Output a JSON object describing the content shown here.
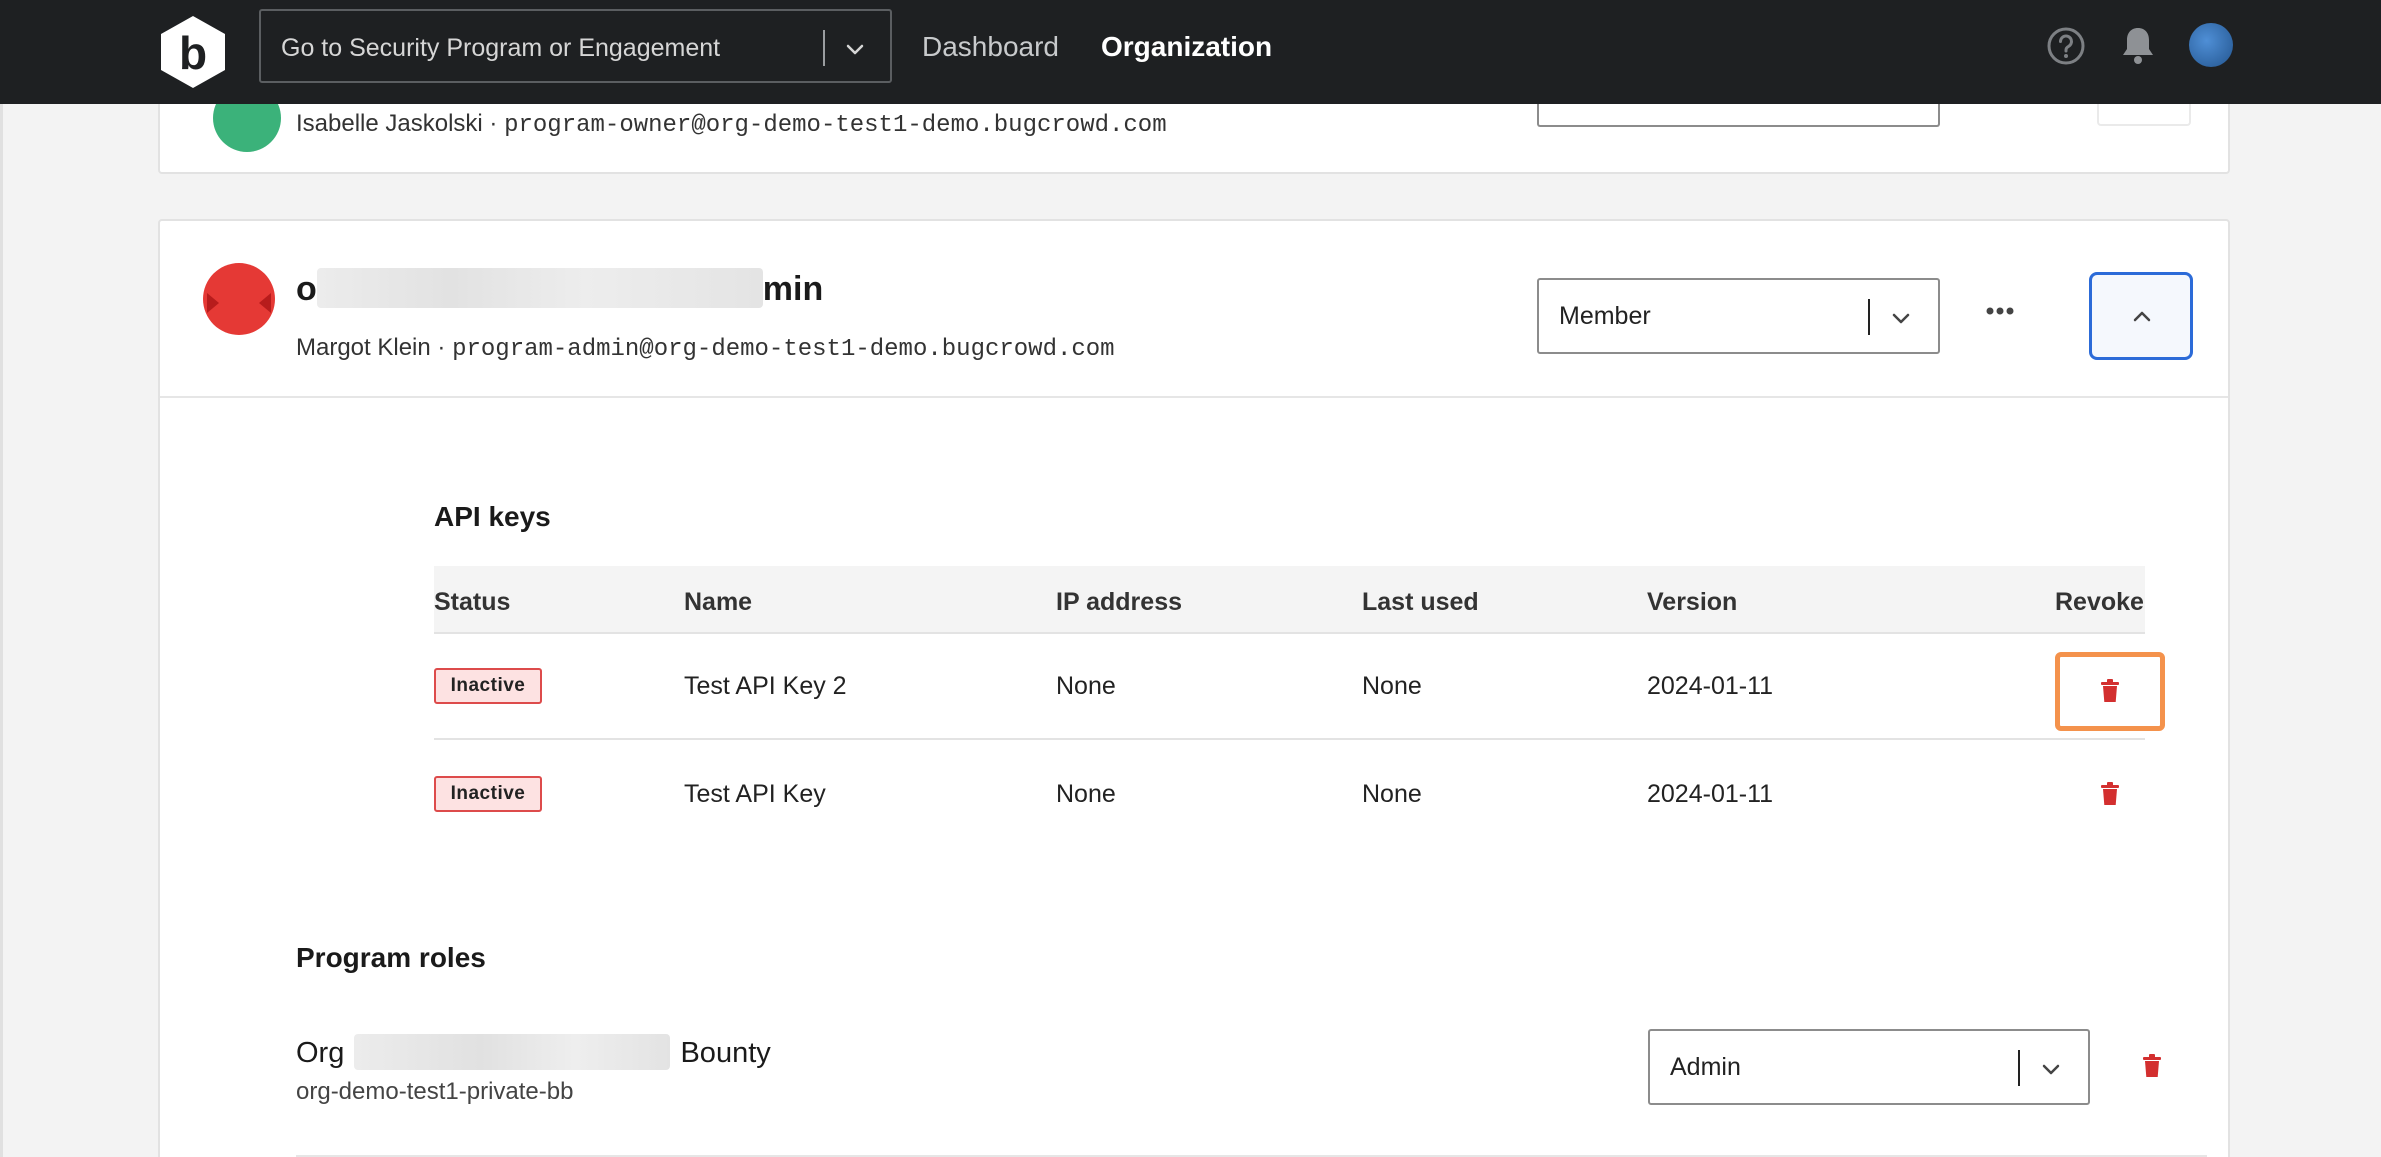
{
  "nav": {
    "logo_letter": "b",
    "search_placeholder": "Go to Security Program or Engagement",
    "links": [
      "Dashboard",
      "Organization"
    ],
    "icons": [
      "help-circle-icon",
      "bell-icon",
      "user-avatar"
    ]
  },
  "member_1": {
    "name": "Isabelle Jaskolski",
    "separator": "·",
    "email": "program-owner@org-demo-test1-demo.bugcrowd.com"
  },
  "member_2": {
    "username_start": "o",
    "username_end": "min",
    "name": "Margot Klein",
    "separator": "·",
    "email": "program-admin@org-demo-test1-demo.bugcrowd.com",
    "role": "Member",
    "actions": [
      "more-icon",
      "chevron-up-icon"
    ]
  },
  "api_keys": {
    "title": "API keys",
    "columns": [
      "Status",
      "Name",
      "IP address",
      "Last used",
      "Version",
      "Revoke"
    ],
    "rows": [
      {
        "status": "Inactive",
        "name": "Test API Key 2",
        "ip": "None",
        "last_used": "None",
        "version": "2024-01-11"
      },
      {
        "status": "Inactive",
        "name": "Test API Key",
        "ip": "None",
        "last_used": "None",
        "version": "2024-01-11"
      }
    ]
  },
  "program_roles": {
    "title": "Program roles",
    "program_name_start": "Org",
    "program_name_end": "Bounty",
    "program_slug": "org-demo-test1-private-bb",
    "role": "Admin"
  },
  "colors": {
    "nav_bg": "#1e2022",
    "primary_blue": "#2c6bd8",
    "danger_red": "#d32f2f",
    "highlight_orange": "#f4924c"
  }
}
